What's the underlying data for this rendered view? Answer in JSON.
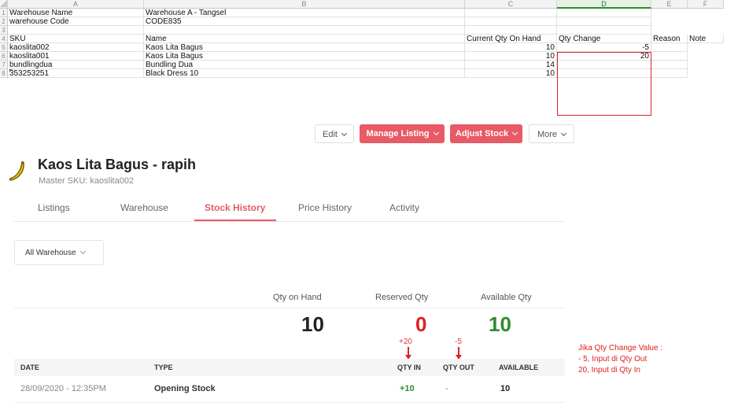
{
  "spreadsheet": {
    "columns": [
      "A",
      "B",
      "C",
      "D",
      "E",
      "F"
    ],
    "rows": [
      "1",
      "2",
      "3",
      "4",
      "5",
      "6",
      "7",
      "8"
    ],
    "meta": [
      {
        "label": "Warehouse Name",
        "value": "Warehouse A - Tangsel"
      },
      {
        "label": "warehouse Code",
        "value": "CODE835"
      }
    ],
    "headers": {
      "sku": "SKU",
      "name": "Name",
      "current_qty": "Current Qty On Hand",
      "qty_change": "Qty Change",
      "reason": "Reason",
      "note": "Note"
    },
    "data_rows": [
      {
        "sku": "kaoslita002",
        "name": "Kaos Lita Bagus",
        "current_qty": "10",
        "qty_change": "-5"
      },
      {
        "sku": "kaoslita001",
        "name": "Kaos Lita Bagus",
        "current_qty": "10",
        "qty_change": "20"
      },
      {
        "sku": "bundlingdua",
        "name": "Bundling Dua",
        "current_qty": "14",
        "qty_change": ""
      },
      {
        "sku": "353253251",
        "name": "Black Dress 10",
        "current_qty": "10",
        "qty_change": ""
      }
    ]
  },
  "toolbar": {
    "edit": "Edit",
    "manage_listing": "Manage Listing",
    "adjust_stock": "Adjust Stock",
    "more": "More"
  },
  "product": {
    "title": "Kaos Lita Bagus - rapih",
    "master_sku": "Master SKU: kaoslita002"
  },
  "tabs": [
    "Listings",
    "Warehouse",
    "Stock History",
    "Price History",
    "Activity"
  ],
  "warehouse_filter": "All Warehouse",
  "summary": {
    "qty_on_hand_label": "Qty on Hand",
    "reserved_label": "Reserved Qty",
    "available_label": "Available Qty",
    "qty_on_hand": "10",
    "reserved": "0",
    "available": "10"
  },
  "annotations": {
    "plus20": "+20",
    "minus5": "-5",
    "line1": "Jika Qty Change Value :",
    "line2": "- 5, Input di Qty Out",
    "line3": "20, Input di Qty In"
  },
  "history": {
    "headers": {
      "date": "DATE",
      "type": "TYPE",
      "qty_in": "QTY IN",
      "qty_out": "QTY OUT",
      "available": "AVAILABLE"
    },
    "rows": [
      {
        "date": "28/09/2020 - 12:35PM",
        "type": "Opening Stock",
        "qty_in": "+10",
        "qty_out": "-",
        "available": "10"
      }
    ]
  },
  "colors": {
    "accent": "#e85a66",
    "positive": "#2e8b2e",
    "negative": "#e02020"
  }
}
